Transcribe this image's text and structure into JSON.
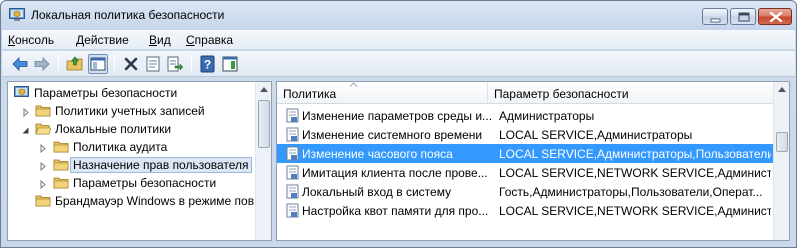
{
  "window": {
    "title": "Локальная политика безопасности"
  },
  "menu": {
    "items": [
      {
        "underline": "К",
        "rest": "онсоль"
      },
      {
        "underline": "Д",
        "rest": "ействие"
      },
      {
        "underline": "В",
        "rest": "ид"
      },
      {
        "underline": "С",
        "rest": "правка"
      }
    ]
  },
  "toolbar": {
    "buttons": [
      "back-icon",
      "forward-icon",
      "up-folder-icon",
      "show-hide-tree-icon",
      "delete-icon",
      "properties-icon",
      "export-icon",
      "help-icon",
      "show-action-pane-icon"
    ]
  },
  "tree": {
    "items": [
      {
        "label": "Параметры безопасности",
        "icon": "security-settings-icon"
      },
      {
        "label": "Политики учетных записей",
        "icon": "folder-icon"
      },
      {
        "label": "Локальные политики",
        "icon": "folder-open-icon"
      },
      {
        "label": "Политика аудита",
        "icon": "folder-icon"
      },
      {
        "label": "Назначение прав пользователя",
        "icon": "folder-icon"
      },
      {
        "label": "Параметры безопасности",
        "icon": "folder-icon"
      },
      {
        "label": "Брандмауэр Windows в режиме пов",
        "icon": "folder-icon"
      }
    ]
  },
  "list": {
    "columns": [
      "Политика",
      "Параметр безопасности"
    ],
    "rows": [
      {
        "policy": "Изменение параметров среды и...",
        "setting": "Администраторы"
      },
      {
        "policy": "Изменение системного времени",
        "setting": "LOCAL SERVICE,Администраторы"
      },
      {
        "policy": "Изменение часового пояса",
        "setting": "LOCAL SERVICE,Администраторы,Пользователи"
      },
      {
        "policy": "Имитация клиента после прове...",
        "setting": "LOCAL SERVICE,NETWORK SERVICE,Администра..."
      },
      {
        "policy": "Локальный вход в систему",
        "setting": "Гость,Администраторы,Пользователи,Операт..."
      },
      {
        "policy": "Настройка квот памяти для про...",
        "setting": "LOCAL SERVICE,NETWORK SERVICE,Администра..."
      }
    ]
  },
  "colors": {
    "selection": "#3399ff",
    "folder": "#e8c25e"
  }
}
